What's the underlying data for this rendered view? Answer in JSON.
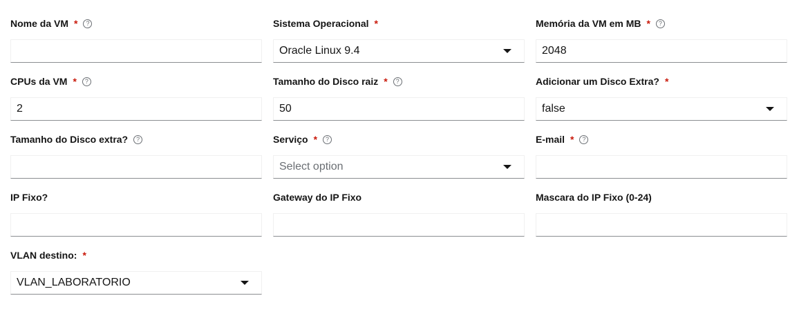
{
  "fields": {
    "vm_name": {
      "label": "Nome da VM",
      "required": "*",
      "help": "?",
      "value": ""
    },
    "os": {
      "label": "Sistema Operacional",
      "required": "*",
      "value": "Oracle Linux 9.4"
    },
    "memory": {
      "label": "Memória da VM em MB",
      "required": "*",
      "help": "?",
      "value": "2048"
    },
    "cpus": {
      "label": "CPUs da VM",
      "required": "*",
      "help": "?",
      "value": "2"
    },
    "root_disk": {
      "label": "Tamanho do Disco raiz",
      "required": "*",
      "help": "?",
      "value": "50"
    },
    "extra_disk_toggle": {
      "label": "Adicionar um Disco Extra?",
      "required": "*",
      "value": "false"
    },
    "extra_disk_size": {
      "label": "Tamanho do Disco extra?",
      "help": "?",
      "value": ""
    },
    "service": {
      "label": "Serviço",
      "required": "*",
      "help": "?",
      "placeholder": "Select option"
    },
    "email": {
      "label": "E-mail",
      "required": "*",
      "help": "?",
      "value": ""
    },
    "fixed_ip": {
      "label": "IP Fixo?",
      "value": ""
    },
    "gateway": {
      "label": "Gateway do IP Fixo",
      "value": ""
    },
    "mask": {
      "label": "Mascara do IP Fixo (0-24)",
      "value": ""
    },
    "vlan": {
      "label": "VLAN destino:",
      "required": "*",
      "value": "VLAN_LABORATORIO"
    }
  },
  "colors": {
    "required": "#c9190b",
    "input_underline": "#8a8d90",
    "placeholder": "#6a6e73",
    "help_icon": "#6a6e73"
  },
  "icons": {
    "help": "question-circle-icon",
    "dropdown": "caret-down-icon"
  }
}
